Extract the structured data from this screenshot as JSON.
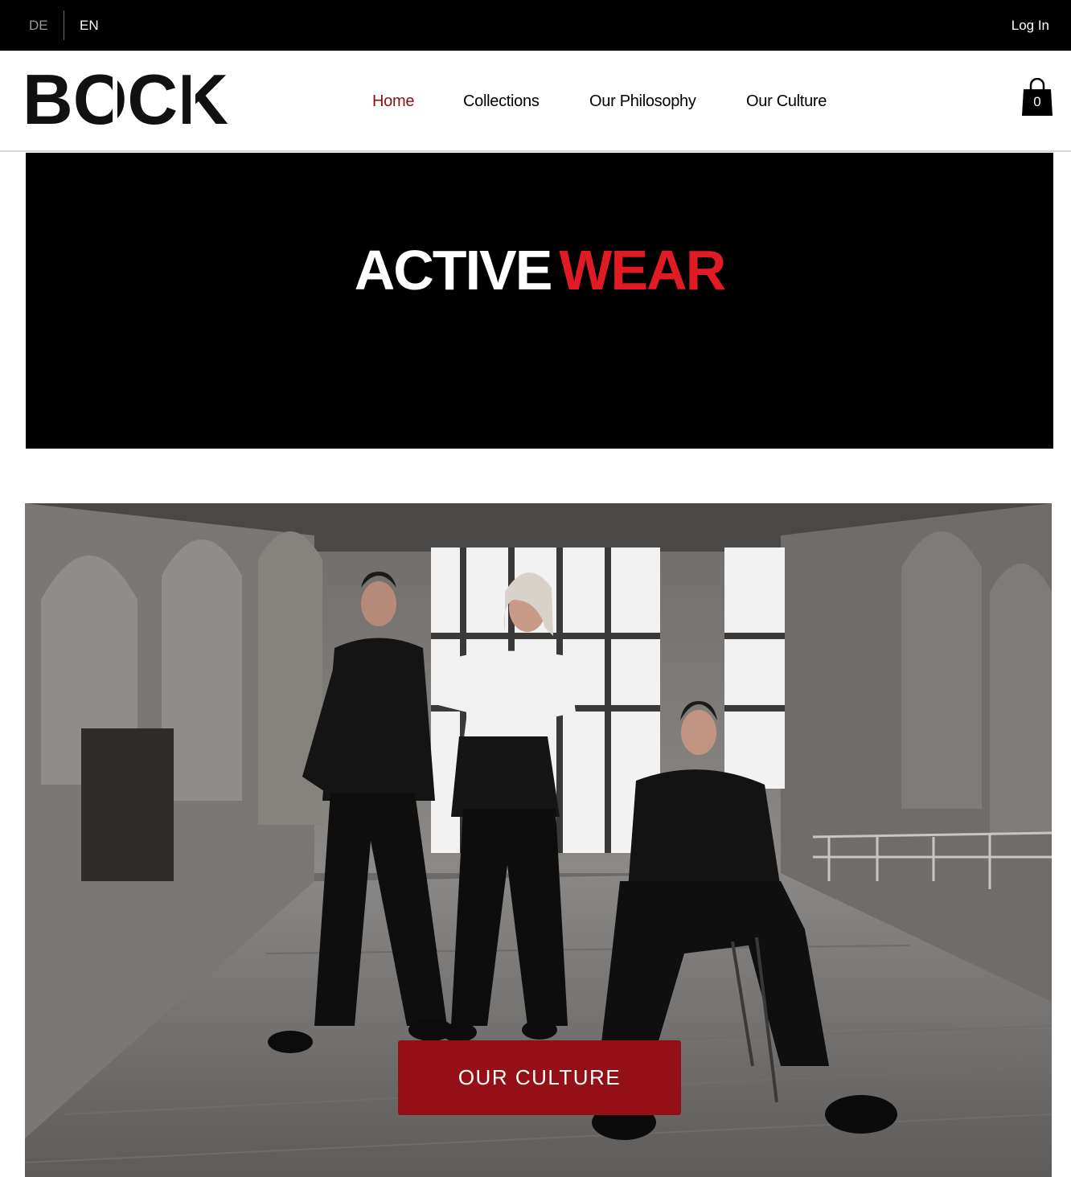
{
  "topbar": {
    "languages": [
      "DE",
      "EN"
    ],
    "active_language": "EN",
    "login_label": "Log In"
  },
  "header": {
    "logo_text": "BOCK",
    "nav": [
      {
        "label": "Home",
        "active": true
      },
      {
        "label": "Collections",
        "active": false
      },
      {
        "label": "Our Philosophy",
        "active": false
      },
      {
        "label": "Our Culture",
        "active": false
      }
    ],
    "cart_count": "0"
  },
  "hero": {
    "title_part1": "ACTIVE",
    "title_part2": "WEAR"
  },
  "photo_section": {
    "cta_label": "OUR CULTURE"
  },
  "colors": {
    "accent_red": "#e11b24",
    "nav_active": "#8e0f14",
    "cta_background": "#951016",
    "topbar_background": "#000000"
  }
}
